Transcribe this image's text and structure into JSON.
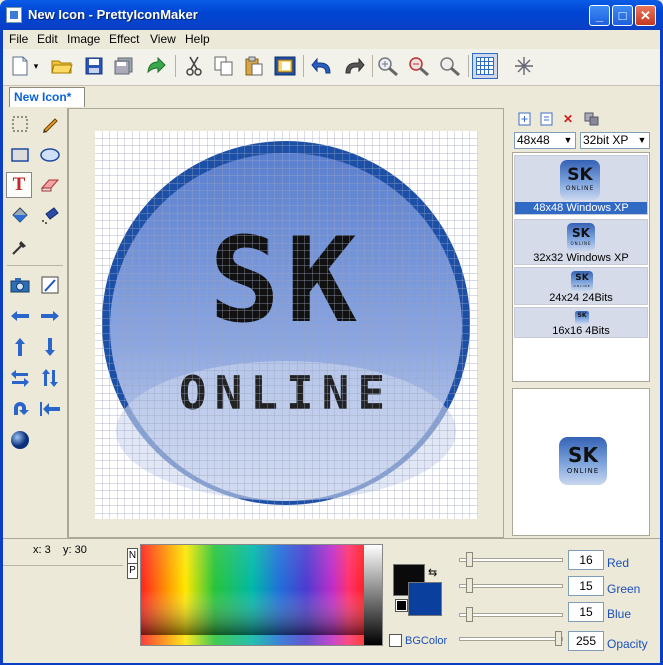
{
  "window": {
    "title": "New Icon - PrettyIconMaker",
    "minimize": "_",
    "maximize": "□",
    "close": "✕"
  },
  "menu": [
    "File",
    "Edit",
    "Image",
    "Effect",
    "View",
    "Help"
  ],
  "toolbar_icons": [
    "new-icon",
    "dropdown-arrow-icon",
    "open-folder-icon",
    "save-icon",
    "save-all-icon",
    "export-arrow-icon",
    "cut-icon",
    "copy-icon",
    "paste-icon",
    "paste-special-icon",
    "undo-icon",
    "redo-icon",
    "zoom-in-icon",
    "zoom-out-icon",
    "zoom-fit-icon",
    "grid-icon",
    "magic-wand-icon"
  ],
  "document_tab": "New Icon*",
  "tools": [
    "select-rect-icon",
    "pencil-icon",
    "rectangle-icon",
    "ellipse-icon",
    "text-icon",
    "eraser-icon",
    "fill-bucket-icon",
    "spray-icon",
    "eyedropper-icon",
    "camera-icon",
    "color-picker-icon",
    "move-left-icon",
    "move-right-icon",
    "move-up-icon",
    "move-down-icon",
    "flip-horizontal-icon",
    "flip-vertical-icon",
    "rotate-icon",
    "shift-left-icon",
    "sphere-icon"
  ],
  "format_panel": {
    "size_select": "48x48",
    "depth_select": "32bit XP",
    "formats": [
      {
        "label": "48x48 Windows XP",
        "selected": true
      },
      {
        "label": "32x32 Windows XP",
        "selected": false
      },
      {
        "label": "24x24 24Bits",
        "selected": false
      },
      {
        "label": "16x16 4Bits",
        "selected": false
      }
    ]
  },
  "icon_text": {
    "main": "SK",
    "sub": "ONLINE"
  },
  "status": {
    "x_label": "x:",
    "x_value": "3",
    "y_label": "y:",
    "y_value": "30"
  },
  "palette_modes": {
    "n": "N",
    "p": "P"
  },
  "colors": {
    "foreground": "#0a0a0a",
    "background": "#0a3f9e",
    "bgcolor_label": "BGColor",
    "accent_blue": "#316ac5"
  },
  "sliders": [
    {
      "name": "Red",
      "value": "16",
      "fraction": 0.063
    },
    {
      "name": "Green",
      "value": "15",
      "fraction": 0.059
    },
    {
      "name": "Blue",
      "value": "15",
      "fraction": 0.059
    },
    {
      "name": "Opacity",
      "value": "255",
      "fraction": 1.0
    }
  ]
}
